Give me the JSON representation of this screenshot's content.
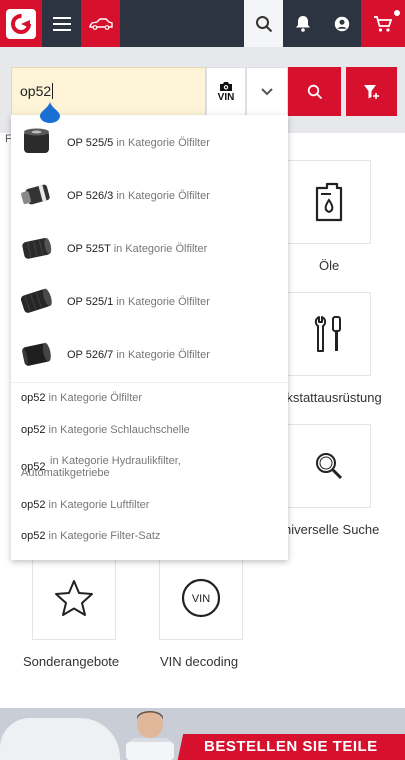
{
  "search": {
    "value": "op52",
    "vin_label": "VIN"
  },
  "colors": {
    "brand_red": "#d7102e",
    "navbar": "#2d3441",
    "input_bg": "#fdf3d7"
  },
  "navbar_icons": [
    "logo-icon",
    "menu-icon",
    "car-icon",
    "search-icon",
    "bell-icon",
    "user-icon",
    "cart-icon"
  ],
  "breadcrumb_fragment": "F",
  "suggestions": {
    "products": [
      {
        "name": "OP 525/5",
        "in": "in Kategorie Ölfilter"
      },
      {
        "name": "OP 526/3",
        "in": "in Kategorie Ölfilter"
      },
      {
        "name": "OP 525T",
        "in": "in Kategorie Ölfilter"
      },
      {
        "name": "OP 525/1",
        "in": "in Kategorie Ölfilter"
      },
      {
        "name": "OP 526/7",
        "in": "in Kategorie Ölfilter"
      }
    ],
    "keywords": [
      {
        "q": "op52",
        "in": "in Kategorie Ölfilter"
      },
      {
        "q": "op52",
        "in": "in Kategorie Schlauchschelle"
      },
      {
        "q": "op52",
        "in": "in Kategorie Hydraulikfilter,",
        "in2": "Automatikgetriebe"
      },
      {
        "q": "op52",
        "in": "in Kategorie Luftfilter"
      },
      {
        "q": "op52",
        "in": "in Kategorie Filter-Satz"
      }
    ]
  },
  "categories": [
    {
      "label": "Öle",
      "icon": "oil-can-icon"
    },
    {
      "label": "rkstattausrüstung",
      "icon": "tools-icon"
    },
    {
      "label": "niverselle Suche",
      "icon": "search-icon"
    },
    {
      "label": "Sonderangebote",
      "icon": "star-icon"
    },
    {
      "label": "VIN decoding",
      "icon": "vin-icon",
      "badge": "VIN"
    }
  ],
  "banner": {
    "text": "BESTELLEN SIE TEILE"
  }
}
